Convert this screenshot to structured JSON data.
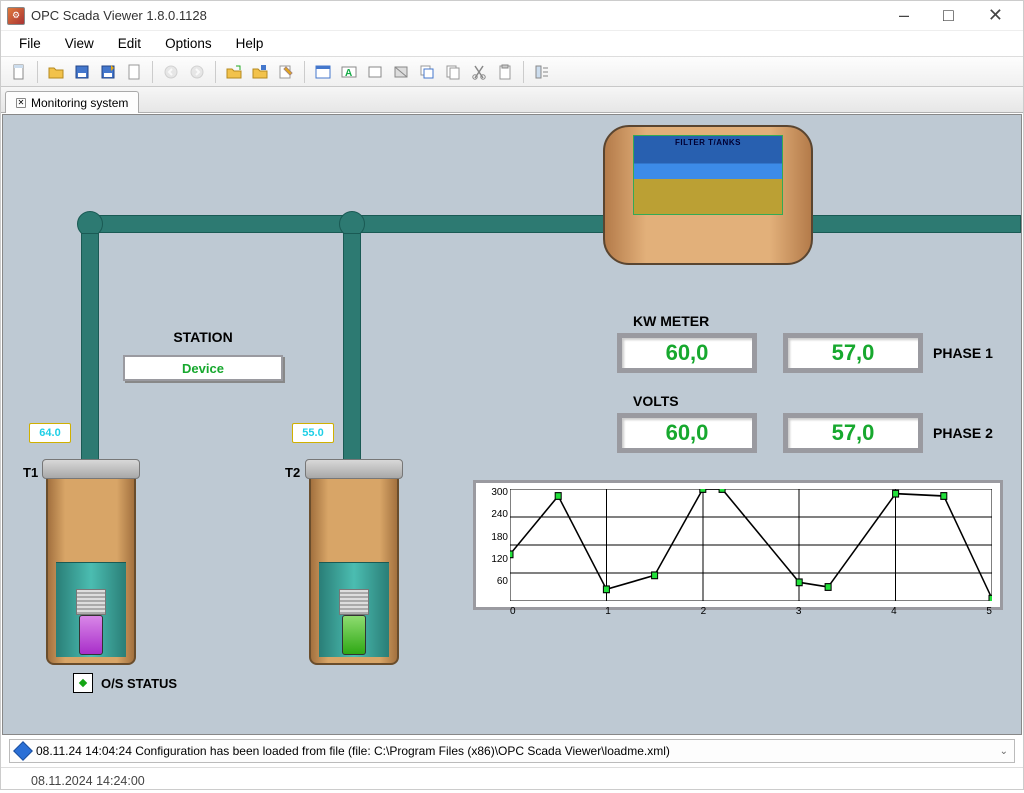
{
  "window": {
    "title": "OPC Scada Viewer 1.8.0.1128",
    "tab": "Monitoring system"
  },
  "menubar": [
    "File",
    "View",
    "Edit",
    "Options",
    "Help"
  ],
  "scada": {
    "filter_tanks_label": "FILTER T/ANKS",
    "station_label": "STATION",
    "station_value": "Device",
    "t1_label": "T1",
    "t1_reading": "64.0",
    "t2_label": "T2",
    "t2_reading": "55.0",
    "os_status_label": "O/S STATUS"
  },
  "meters": {
    "kw_label": "KW METER",
    "volts_label": "VOLTS",
    "phase1_label": "PHASE 1",
    "phase2_label": "PHASE 2",
    "kw_value": "60,0",
    "volts_value": "60,0",
    "phase1_value": "57,0",
    "phase2_value": "57,0"
  },
  "chart_data": {
    "type": "line",
    "x": [
      0,
      0.5,
      1,
      1.5,
      2,
      2.2,
      3,
      3.3,
      4,
      4.5,
      5
    ],
    "values": [
      160,
      285,
      85,
      115,
      300,
      300,
      100,
      90,
      290,
      285,
      65
    ],
    "xlabel": "",
    "ylabel": "",
    "y_ticks": [
      300,
      240,
      180,
      120,
      60
    ],
    "x_ticks": [
      0,
      1,
      2,
      3,
      4,
      5
    ],
    "ylim": [
      60,
      300
    ],
    "xlim": [
      0,
      5
    ]
  },
  "status": {
    "message": "08.11.24 14:04:24 Configuration has been loaded from file (file: C:\\Program Files (x86)\\OPC Scada Viewer\\loadme.xml)",
    "clock": "08.11.2024 14:24:00"
  }
}
